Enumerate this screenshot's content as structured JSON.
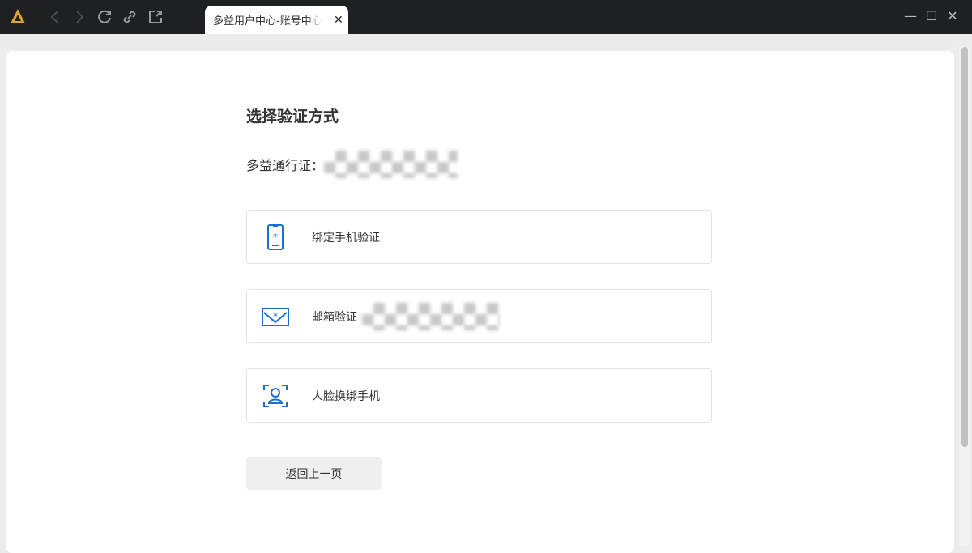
{
  "browser": {
    "tab_title": "多益用户中心-账号中心",
    "close_tab": "✕",
    "minimize": "—",
    "maximize": "☐",
    "close": "✕"
  },
  "page": {
    "title": "选择验证方式",
    "account_label": "多益通行证：",
    "options": [
      {
        "label": "绑定手机验证",
        "icon": "phone-icon"
      },
      {
        "label": "邮箱验证",
        "icon": "mail-icon"
      },
      {
        "label": "人脸换绑手机",
        "icon": "face-icon"
      }
    ],
    "back_label": "返回上一页",
    "accent": "#1a6fd0"
  }
}
